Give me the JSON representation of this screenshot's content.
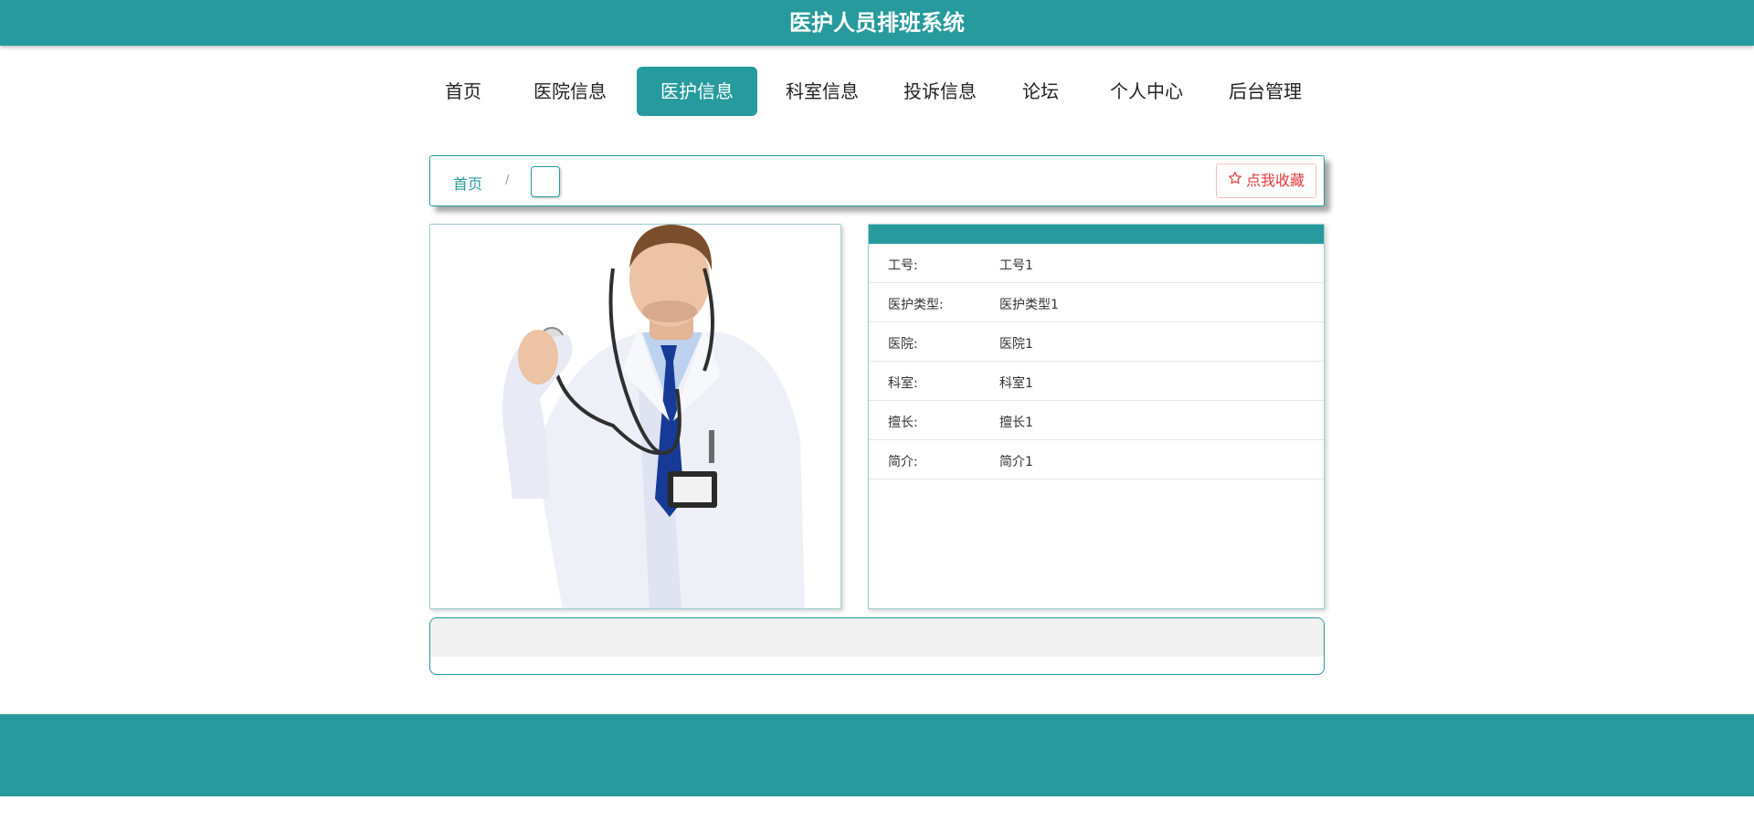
{
  "header": {
    "title": "医护人员排班系统"
  },
  "nav": {
    "items": [
      {
        "label": "首页"
      },
      {
        "label": "医院信息"
      },
      {
        "label": "医护信息"
      },
      {
        "label": "科室信息"
      },
      {
        "label": "投诉信息"
      },
      {
        "label": "论坛"
      },
      {
        "label": "个人中心"
      },
      {
        "label": "后台管理"
      }
    ],
    "active": "医护信息"
  },
  "breadcrumb": {
    "home": "首页",
    "separator": "/",
    "current": ""
  },
  "favorite": {
    "label": "点我收藏",
    "icon": "star-outline-icon"
  },
  "detail": {
    "rows": [
      {
        "key": "工号:",
        "value": "工号1"
      },
      {
        "key": "医护类型:",
        "value": "医护类型1"
      },
      {
        "key": "医院:",
        "value": "医院1"
      },
      {
        "key": "科室:",
        "value": "科室1"
      },
      {
        "key": "擅长:",
        "value": "擅长1"
      },
      {
        "key": "简介:",
        "value": "简介1"
      }
    ]
  },
  "colors": {
    "primary": "#269a9c",
    "favorite": "#e33b3b",
    "panel_gray": "#f1f1f1"
  }
}
